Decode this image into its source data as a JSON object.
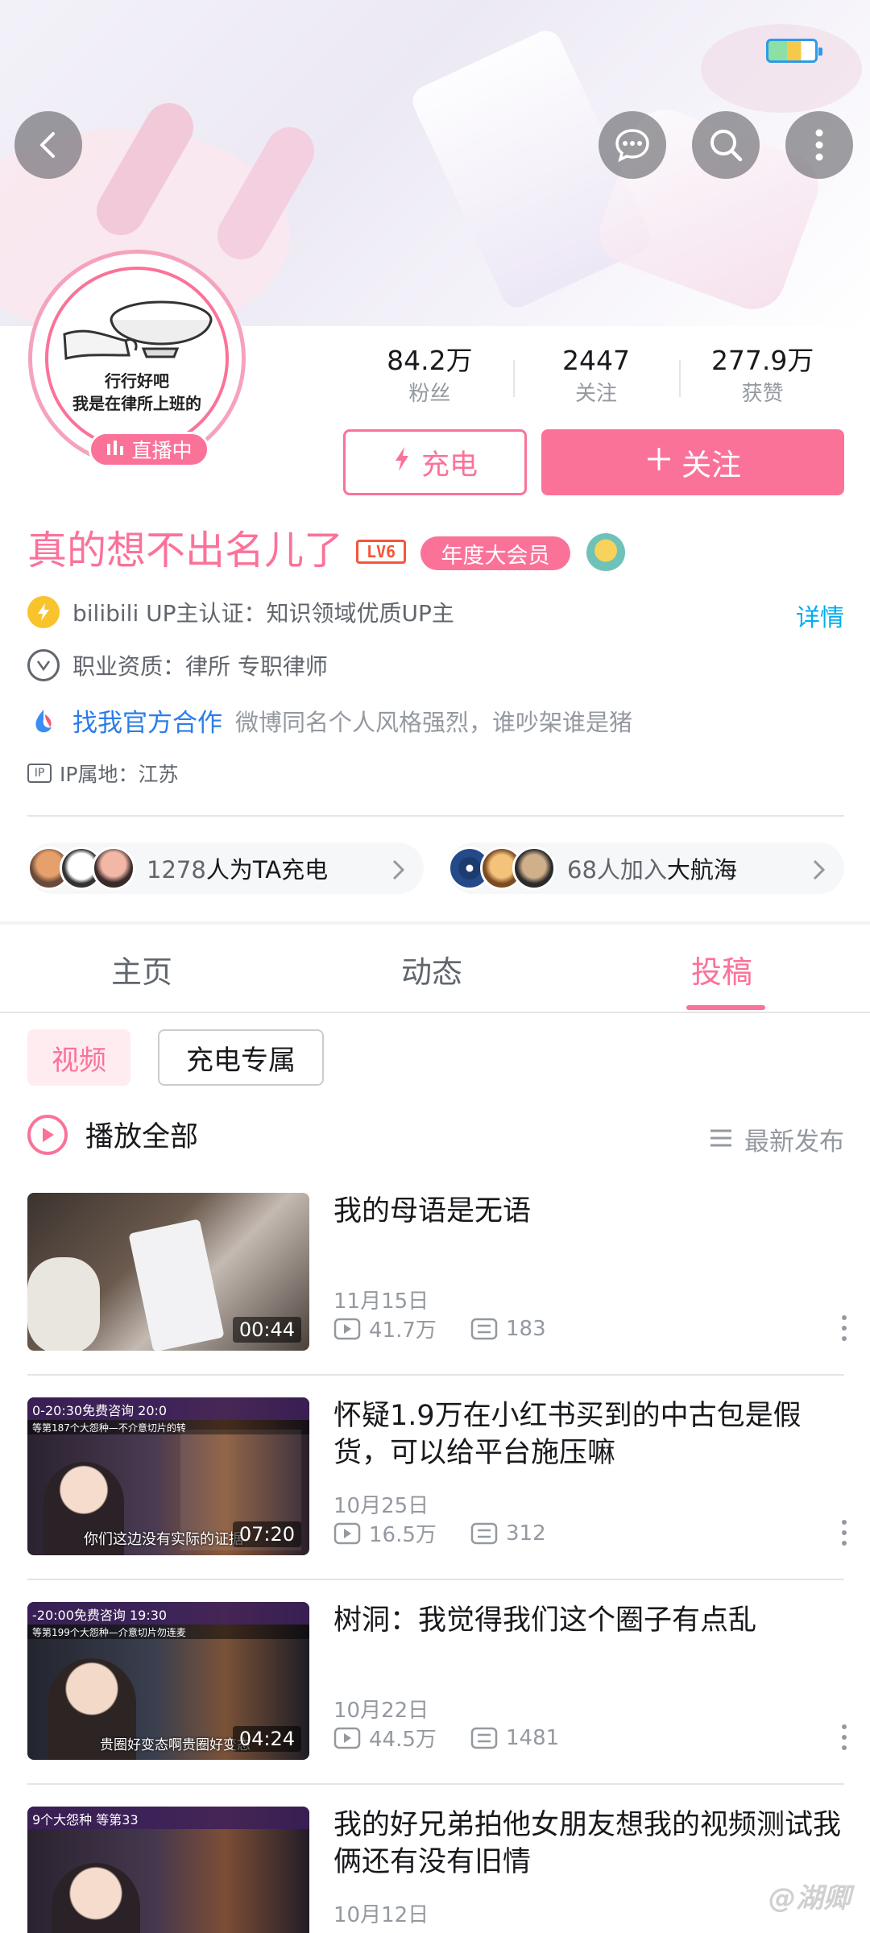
{
  "header": {
    "back_icon": "back-arrow-icon",
    "message_icon": "chat-bubble-icon",
    "search_icon": "search-icon",
    "more_icon": "more-vertical-icon"
  },
  "profile": {
    "avatar_caption_1": "行行好吧",
    "avatar_caption_2": "我是在律所上班的",
    "live_label": "直播中",
    "stats": [
      {
        "value": "84.2万",
        "label": "粉丝"
      },
      {
        "value": "2447",
        "label": "关注"
      },
      {
        "value": "277.9万",
        "label": "获赞"
      }
    ],
    "charge_label": "充电",
    "follow_label": "关注",
    "name": "真的想不出名儿了",
    "level": "LV6",
    "vip_label": "年度大会员",
    "cert_text": "bilibili UP主认证：知识领域优质UP主",
    "detail_link": "详情",
    "job_text": "职业资质：律所 专职律师",
    "cooperation_link": "找我官方合作",
    "bio": "微博同名个人风格强烈，谁吵架谁是猪",
    "ip_tag": "IP",
    "ip_text": "IP属地：江苏",
    "chargers_count": "1278",
    "chargers_suffix": "人为TA充电",
    "crew_count": "68人加入",
    "crew_suffix": "大航海"
  },
  "tabs": [
    {
      "label": "主页",
      "active": false
    },
    {
      "label": "动态",
      "active": false
    },
    {
      "label": "投稿",
      "active": true
    }
  ],
  "filters": [
    {
      "label": "视频",
      "active": true
    },
    {
      "label": "充电专属",
      "active": false
    }
  ],
  "list_header": {
    "play_all": "播放全部",
    "sort": "最新发布"
  },
  "videos": [
    {
      "title": "我的母语是无语",
      "date": "11月15日",
      "views": "41.7万",
      "comments": "183",
      "duration": "00:44",
      "overlay": ""
    },
    {
      "title": "怀疑1.9万在小红书买到的中古包是假货，可以给平台施压嘛",
      "date": "10月25日",
      "views": "16.5万",
      "comments": "312",
      "duration": "07:20",
      "overlay": "你们这边没有实际的证据",
      "banner": "0-20:30免费咨询 20:0",
      "banner2": "等第187个大怨种—不介意切片的转"
    },
    {
      "title": "树洞：我觉得我们这个圈子有点乱",
      "date": "10月22日",
      "views": "44.5万",
      "comments": "1481",
      "duration": "04:24",
      "overlay": "贵圈好变态啊贵圈好变态",
      "banner": "-20:00免费咨询 19:30",
      "banner2": "等第199个大怨种—介意切片勿连麦"
    },
    {
      "title": "我的好兄弟拍他女朋友想我的视频测试我俩还有没有旧情",
      "date": "10月12日",
      "views": "",
      "comments": "",
      "duration": "",
      "overlay": "",
      "banner": "9个大怨种 等第33"
    }
  ],
  "watermark": "@湖卿",
  "colors": {
    "accent": "#fb7299",
    "link": "#00aeec",
    "muted": "#9499a0"
  }
}
